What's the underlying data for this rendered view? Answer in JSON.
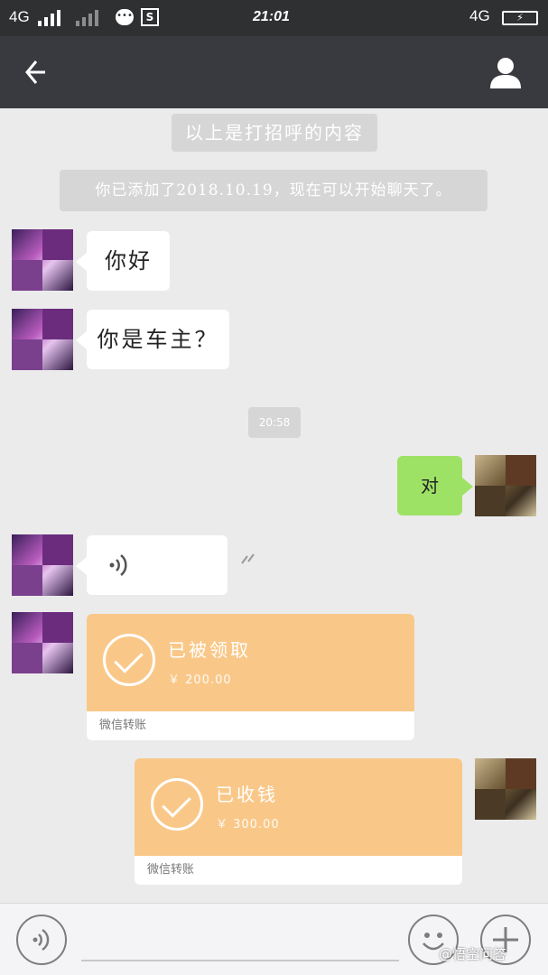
{
  "statusbar": {
    "network_left": "4G",
    "notification_icon": "chat-bubble-icon",
    "s_icon_label": "S",
    "time": "21:01",
    "network_right": "4G",
    "battery_icon": "battery-charging-icon"
  },
  "navbar": {
    "back_icon": "back-arrow-icon",
    "profile_icon": "person-icon"
  },
  "messages": {
    "system_greeting": "以上是打招呼的内容",
    "system_added": "你已添加了2018.10.19，现在可以开始聊天了。",
    "msg1": "你好",
    "msg2": "你是车主？",
    "timestamp": "20:58",
    "reply1": "对",
    "voice_icon": "voice-wave-icon",
    "transfer_received": {
      "status": "已被领取",
      "amount": "￥ 200.00",
      "footer": "微信转账"
    },
    "transfer_collected": {
      "status": "已收钱",
      "amount": "￥ 300.00",
      "footer": "微信转账"
    }
  },
  "toolbar": {
    "voice_icon": "voice-input-icon",
    "emoji_icon": "emoji-icon",
    "plus_icon": "plus-icon"
  },
  "watermark": "@悟空问答",
  "colors": {
    "navbar": "#393a3f",
    "chat_bg": "#ebebeb",
    "my_bubble": "#9ee265",
    "transfer": "#f9c889"
  }
}
